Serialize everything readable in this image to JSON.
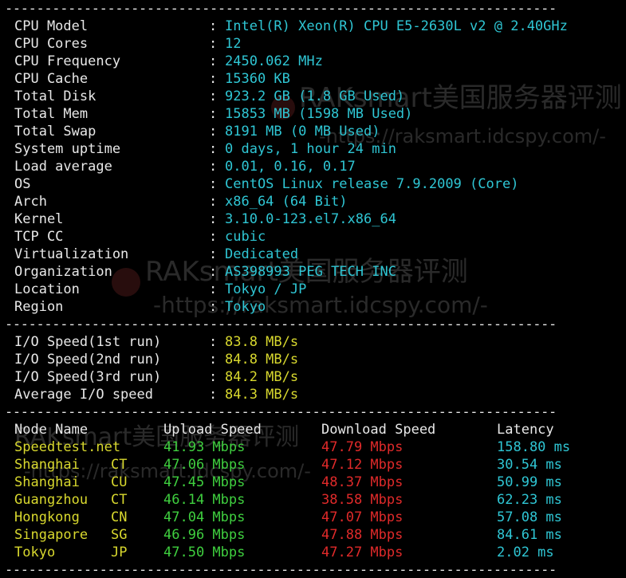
{
  "separator": "----------------------------------------------------------------------",
  "system": [
    {
      "label": "CPU Model",
      "value": "Intel(R) Xeon(R) CPU E5-2630L v2 @ 2.40GHz"
    },
    {
      "label": "CPU Cores",
      "value": "12"
    },
    {
      "label": "CPU Frequency",
      "value": "2450.062 MHz"
    },
    {
      "label": "CPU Cache",
      "value": "15360 KB"
    },
    {
      "label": "Total Disk",
      "value": "923.2 GB (1.8 GB Used)"
    },
    {
      "label": "Total Mem",
      "value": "15853 MB (1598 MB Used)"
    },
    {
      "label": "Total Swap",
      "value": "8191 MB (0 MB Used)"
    },
    {
      "label": "System uptime",
      "value": "0 days, 1 hour 24 min"
    },
    {
      "label": "Load average",
      "value": "0.01, 0.16, 0.17"
    },
    {
      "label": "OS",
      "value": "CentOS Linux release 7.9.2009 (Core)"
    },
    {
      "label": "Arch",
      "value": "x86_64 (64 Bit)"
    },
    {
      "label": "Kernel",
      "value": "3.10.0-123.el7.x86_64"
    },
    {
      "label": "TCP CC",
      "value": "cubic"
    },
    {
      "label": "Virtualization",
      "value": "Dedicated"
    },
    {
      "label": "Organization",
      "value": "AS398993 PEG TECH INC"
    },
    {
      "label": "Location",
      "value": "Tokyo / JP"
    },
    {
      "label": "Region",
      "value": "Tokyo"
    }
  ],
  "io": [
    {
      "label": "I/O Speed(1st run)",
      "value": "83.8 MB/s"
    },
    {
      "label": "I/O Speed(2nd run)",
      "value": "84.8 MB/s"
    },
    {
      "label": "I/O Speed(3rd run)",
      "value": "84.2 MB/s"
    },
    {
      "label": "Average I/O speed",
      "value": "84.3 MB/s"
    }
  ],
  "speed_headers": {
    "node": "Node Name",
    "upload": "Upload Speed",
    "download": "Download Speed",
    "latency": "Latency"
  },
  "speed": [
    {
      "node": "Speedtest.net",
      "isp": "",
      "upload": "41.93 Mbps",
      "download": "47.79 Mbps",
      "latency": "158.80 ms"
    },
    {
      "node": "Shanghai",
      "isp": "CT",
      "upload": "47.06 Mbps",
      "download": "47.12 Mbps",
      "latency": "30.54 ms"
    },
    {
      "node": "Shanghai",
      "isp": "CU",
      "upload": "47.45 Mbps",
      "download": "48.37 Mbps",
      "latency": "50.99 ms"
    },
    {
      "node": "Guangzhou",
      "isp": "CT",
      "upload": "46.14 Mbps",
      "download": "38.58 Mbps",
      "latency": "62.23 ms"
    },
    {
      "node": "Hongkong",
      "isp": "CN",
      "upload": "47.04 Mbps",
      "download": "47.07 Mbps",
      "latency": "57.08 ms"
    },
    {
      "node": "Singapore",
      "isp": "SG",
      "upload": "46.96 Mbps",
      "download": "47.88 Mbps",
      "latency": "84.61 ms"
    },
    {
      "node": "Tokyo",
      "isp": "JP",
      "upload": "47.50 Mbps",
      "download": "47.27 Mbps",
      "latency": "2.02 ms"
    }
  ],
  "watermarks": {
    "brand": "RAKsmart美国服务器评测",
    "url": "-https://raksmart.idcspy.com/-"
  },
  "colors": {
    "background": "#000000",
    "label": "#e8e8e8",
    "value_cyan": "#2fc6d4",
    "value_yellow": "#d8d82e",
    "upload_green": "#3fcf3f",
    "download_red": "#e02a2a"
  }
}
